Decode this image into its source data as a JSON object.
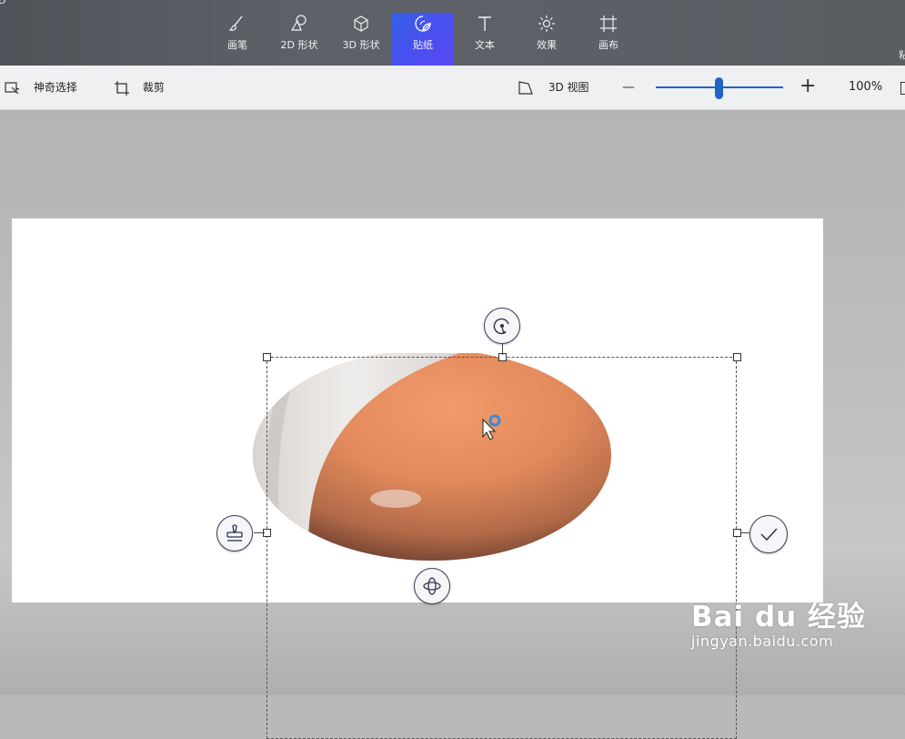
{
  "titlebar": {
    "left_fragment": "D",
    "right_fragment": "粘"
  },
  "ribbon": {
    "tools": [
      {
        "label": "画笔",
        "icon": "brush-icon"
      },
      {
        "label": "2D 形状",
        "icon": "shapes-2d-icon"
      },
      {
        "label": "3D 形状",
        "icon": "cube-icon"
      },
      {
        "label": "贴纸",
        "icon": "sticker-icon",
        "active": true
      },
      {
        "label": "文本",
        "icon": "text-icon"
      },
      {
        "label": "效果",
        "icon": "sun-icon"
      },
      {
        "label": "画布",
        "icon": "canvas-icon"
      }
    ]
  },
  "toolbar": {
    "magic_select": "神奇选择",
    "crop": "裁剪",
    "view_3d": "3D 视图",
    "zoom_minus": "—",
    "zoom_plus": "+",
    "zoom_value": "100%",
    "zoom_level_fraction": 0.5
  },
  "sticker_controls": [
    "rotate-icon",
    "stamp-icon",
    "confirm-check-icon",
    "free-rotate-icon"
  ],
  "colors": {
    "accent": "#1f63c4",
    "active_tab": "#4a4ef0",
    "canvas": "#ffffff"
  },
  "watermark": {
    "logo": "Bai du 经验",
    "url": "jingyan.baidu.com"
  }
}
